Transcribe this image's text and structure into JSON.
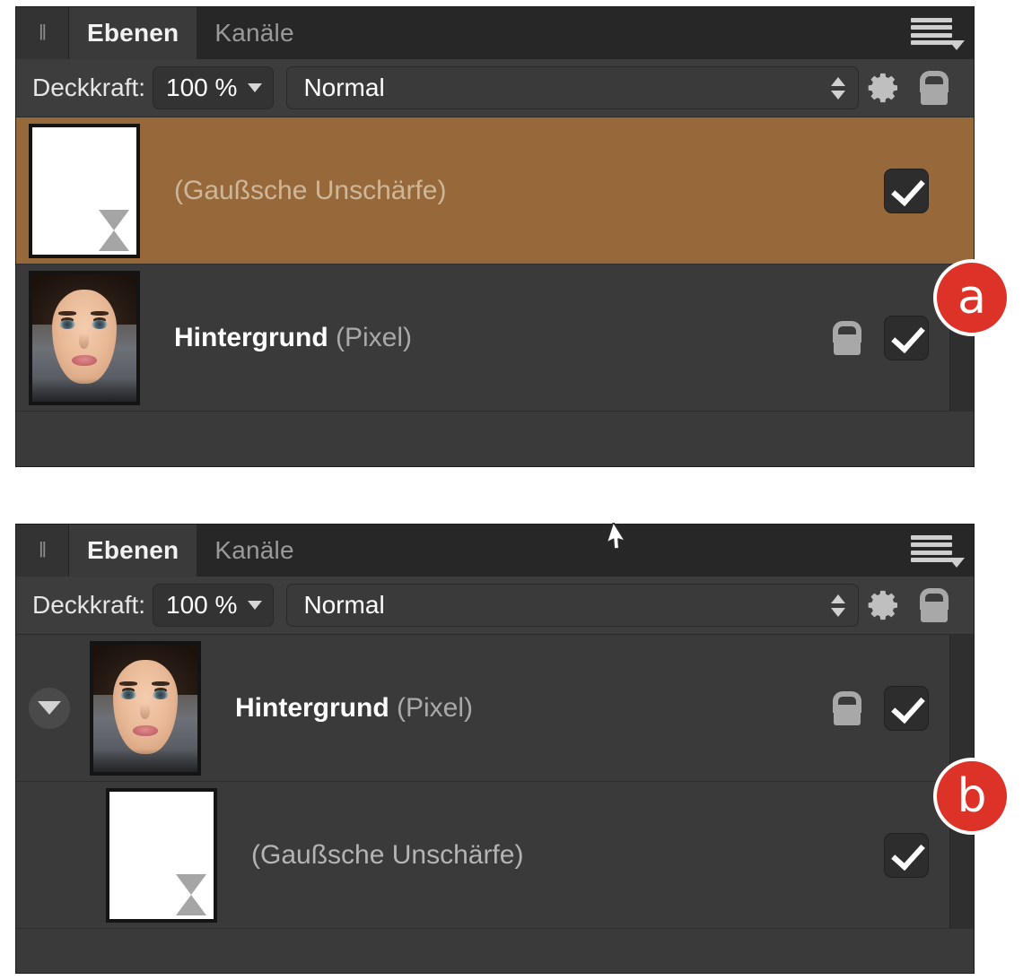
{
  "panels": [
    {
      "id": "a",
      "badge": "a",
      "tabs": [
        {
          "label": "Ebenen",
          "active": true
        },
        {
          "label": "Kanäle",
          "active": false
        }
      ],
      "grip_icon": "drag-handle-icon",
      "menu_icon": "panel-menu-icon",
      "toolbar": {
        "opacity_label": "Deckkraft:",
        "opacity_value": "100 %",
        "opacity_caret_icon": "chevron-down-icon",
        "blend_mode": "Normal",
        "stepper_icon": "spinner-arrows-icon",
        "gear_icon": "gear-icon",
        "lock_icon": "lock-icon"
      },
      "layers": [
        {
          "name": "",
          "kind": "(Gaußsche Unschärfe)",
          "thumb": "white-mask",
          "thumb_badge_icon": "hourglass-icon",
          "selected": true,
          "locked": false,
          "visible": true,
          "child": false,
          "disclosure": false
        },
        {
          "name": "Hintergrund",
          "kind": "(Pixel)",
          "thumb": "portrait-photo",
          "thumb_badge_icon": "",
          "selected": false,
          "locked": true,
          "visible": true,
          "child": false,
          "disclosure": false
        }
      ]
    },
    {
      "id": "b",
      "badge": "b",
      "tabs": [
        {
          "label": "Ebenen",
          "active": true
        },
        {
          "label": "Kanäle",
          "active": false
        }
      ],
      "grip_icon": "drag-handle-icon",
      "menu_icon": "panel-menu-icon",
      "cursor_icon": "move-layer-cursor",
      "toolbar": {
        "opacity_label": "Deckkraft:",
        "opacity_value": "100 %",
        "opacity_caret_icon": "chevron-down-icon",
        "blend_mode": "Normal",
        "stepper_icon": "spinner-arrows-icon",
        "gear_icon": "gear-icon",
        "lock_icon": "lock-icon"
      },
      "layers": [
        {
          "name": "Hintergrund",
          "kind": "(Pixel)",
          "thumb": "portrait-photo",
          "thumb_badge_icon": "",
          "selected": false,
          "locked": true,
          "visible": true,
          "child": false,
          "disclosure": true,
          "disclosure_icon": "triangle-down-icon"
        },
        {
          "name": "",
          "kind": "(Gaußsche Unschärfe)",
          "thumb": "white-mask",
          "thumb_badge_icon": "hourglass-icon",
          "selected": false,
          "locked": false,
          "visible": true,
          "child": true,
          "disclosure": false
        }
      ]
    }
  ],
  "colors": {
    "panel_bg": "#3a3a3a",
    "tabbar_bg": "#272727",
    "toolbar_bg": "#3d3d3d",
    "selected_layer": "#97693a",
    "badge_red": "#dc3228",
    "text_primary": "#ffffff",
    "text_muted": "#a9a9a9"
  }
}
